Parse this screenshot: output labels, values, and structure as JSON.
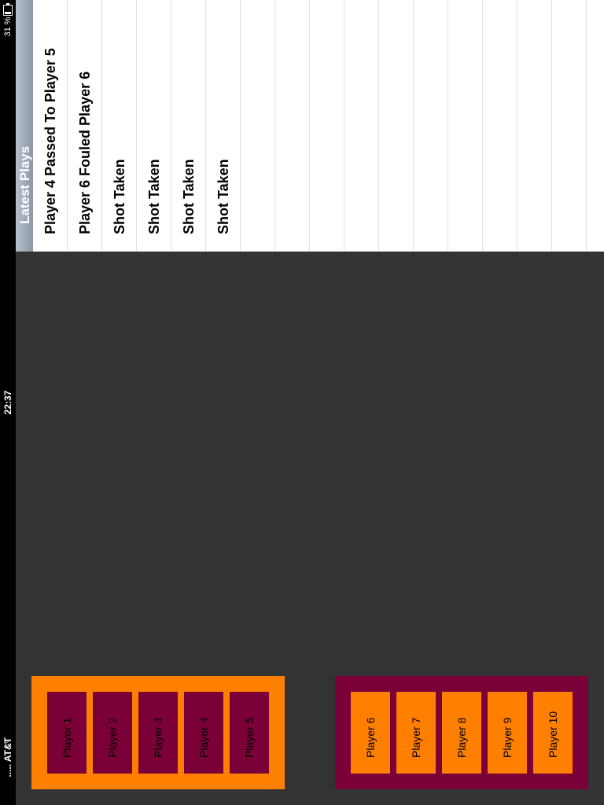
{
  "status_bar": {
    "carrier": "..... AT&T",
    "wifi_icon": "wifi-icon",
    "time": "22:37",
    "battery_percent": "31 %",
    "battery_icon": "battery-icon"
  },
  "latest_plays": {
    "title": "Latest Plays",
    "items": [
      "Player 4 Passed To Player 5",
      "Player 6 Fouled Player 6",
      "Shot Taken",
      "Shot Taken",
      "Shot Taken",
      "Shot Taken",
      "",
      "",
      "",
      "",
      "",
      "",
      "",
      "",
      "",
      "",
      ""
    ]
  },
  "teams": {
    "home": {
      "color": "#ff8000",
      "player_color": "#7b0038",
      "players": [
        "Player 1",
        "Player 2",
        "Player 3",
        "Player 4",
        "Player 5"
      ]
    },
    "away": {
      "color": "#7b0038",
      "player_color": "#ff8000",
      "players": [
        "Player 6",
        "Player 7",
        "Player 8",
        "Player 9",
        "Player 10"
      ]
    }
  },
  "colors": {
    "background": "#333333",
    "panel": "#ffffff",
    "header": "#8a97a5"
  }
}
